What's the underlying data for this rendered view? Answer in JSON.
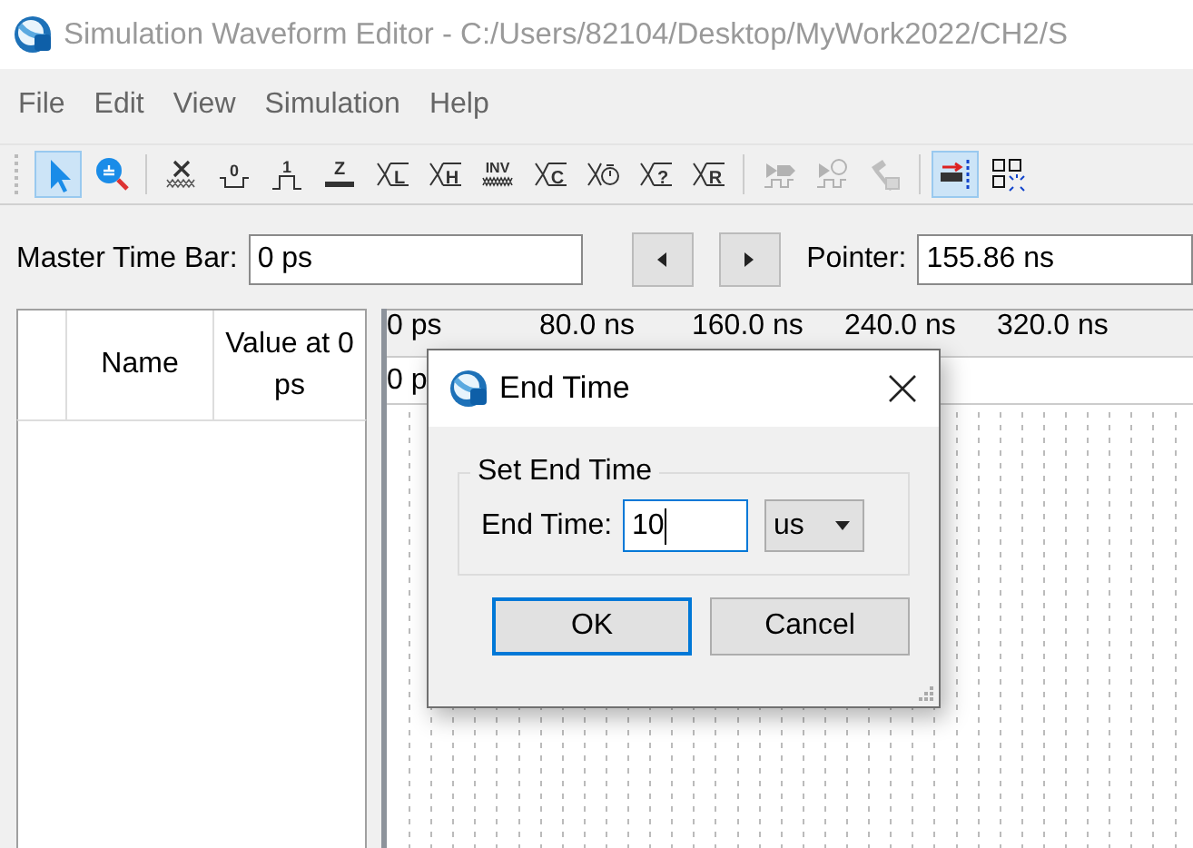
{
  "window": {
    "title": "Simulation Waveform Editor - C:/Users/82104/Desktop/MyWork2022/CH2/S"
  },
  "menu": [
    "File",
    "Edit",
    "View",
    "Simulation",
    "Help"
  ],
  "toolbar": [
    [
      {
        "kind": "pointer",
        "selected": true,
        "disabled": false
      },
      {
        "kind": "zoom",
        "selected": false,
        "disabled": false
      }
    ],
    [
      {
        "kind": "unknown",
        "selected": false,
        "disabled": false
      },
      {
        "kind": "zero",
        "glyph": "0",
        "selected": false,
        "disabled": false
      },
      {
        "kind": "one",
        "glyph": "1",
        "selected": false,
        "disabled": false
      },
      {
        "kind": "highz",
        "glyph": "Z",
        "selected": false,
        "disabled": false
      },
      {
        "kind": "letter",
        "glyph": "L",
        "selected": false,
        "disabled": false
      },
      {
        "kind": "letter",
        "glyph": "H",
        "selected": false,
        "disabled": false
      },
      {
        "kind": "invert",
        "glyph": "INV",
        "selected": false,
        "disabled": false
      },
      {
        "kind": "letter",
        "glyph": "C",
        "selected": false,
        "disabled": false
      },
      {
        "kind": "count",
        "selected": false,
        "disabled": false
      },
      {
        "kind": "letter",
        "glyph": "?",
        "selected": false,
        "disabled": false
      },
      {
        "kind": "letter",
        "glyph": "R",
        "selected": false,
        "disabled": false
      }
    ],
    [
      {
        "kind": "run",
        "selected": false,
        "disabled": true
      },
      {
        "kind": "run-timed",
        "selected": false,
        "disabled": true
      },
      {
        "kind": "build",
        "selected": false,
        "disabled": true
      }
    ],
    [
      {
        "kind": "end-marker",
        "selected": true,
        "disabled": false
      },
      {
        "kind": "snap",
        "selected": false,
        "disabled": false
      }
    ]
  ],
  "time_bar": {
    "master_label": "Master Time Bar:",
    "master_value": "0 ps",
    "pointer_label": "Pointer:",
    "pointer_value": "155.86 ns"
  },
  "signal_list": {
    "columns": [
      "Name",
      "Value at 0 ps"
    ]
  },
  "ruler": {
    "labels": [
      "0 ps",
      "80.0 ns",
      "160.0 ns",
      "240.0 ns",
      "320.0 ns"
    ],
    "second_row": "0 p"
  },
  "dialog": {
    "title": "End Time",
    "group": "Set End Time",
    "field_label": "End Time:",
    "value": "10",
    "unit": "us",
    "buttons": [
      {
        "label": "OK",
        "default": true
      },
      {
        "label": "Cancel",
        "default": false
      }
    ]
  }
}
